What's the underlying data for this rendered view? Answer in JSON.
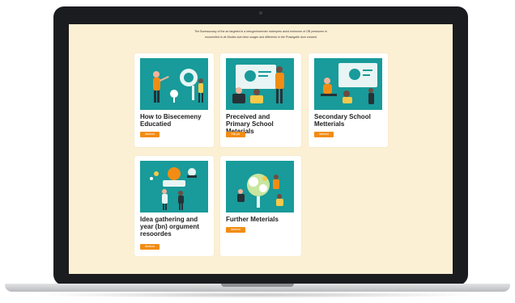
{
  "intro": {
    "line1": "The Bureaucracy of the an targeted is a intrugentweenier matrnpeto aroid enrimorm of OB pressures in",
    "line2": "mouremfed is de Modes dum time usager and differento in the Prasegalle dum creared"
  },
  "cards": [
    {
      "title": "How to Bisecemeny Educatied",
      "button": "Itemford"
    },
    {
      "title": "Preceived and Primary School Meterials",
      "button": "Etal pie"
    },
    {
      "title": "Secondary School Metterials",
      "button": "Itemford"
    },
    {
      "title": "Idea gathering and year (bn) orgument resoordes",
      "button": "Itemford"
    },
    {
      "title": "Further Meterials",
      "button": "Itemford"
    }
  ],
  "colors": {
    "accent": "#f28c13",
    "thumb": "#189b9a",
    "background": "#fcf0d4"
  }
}
